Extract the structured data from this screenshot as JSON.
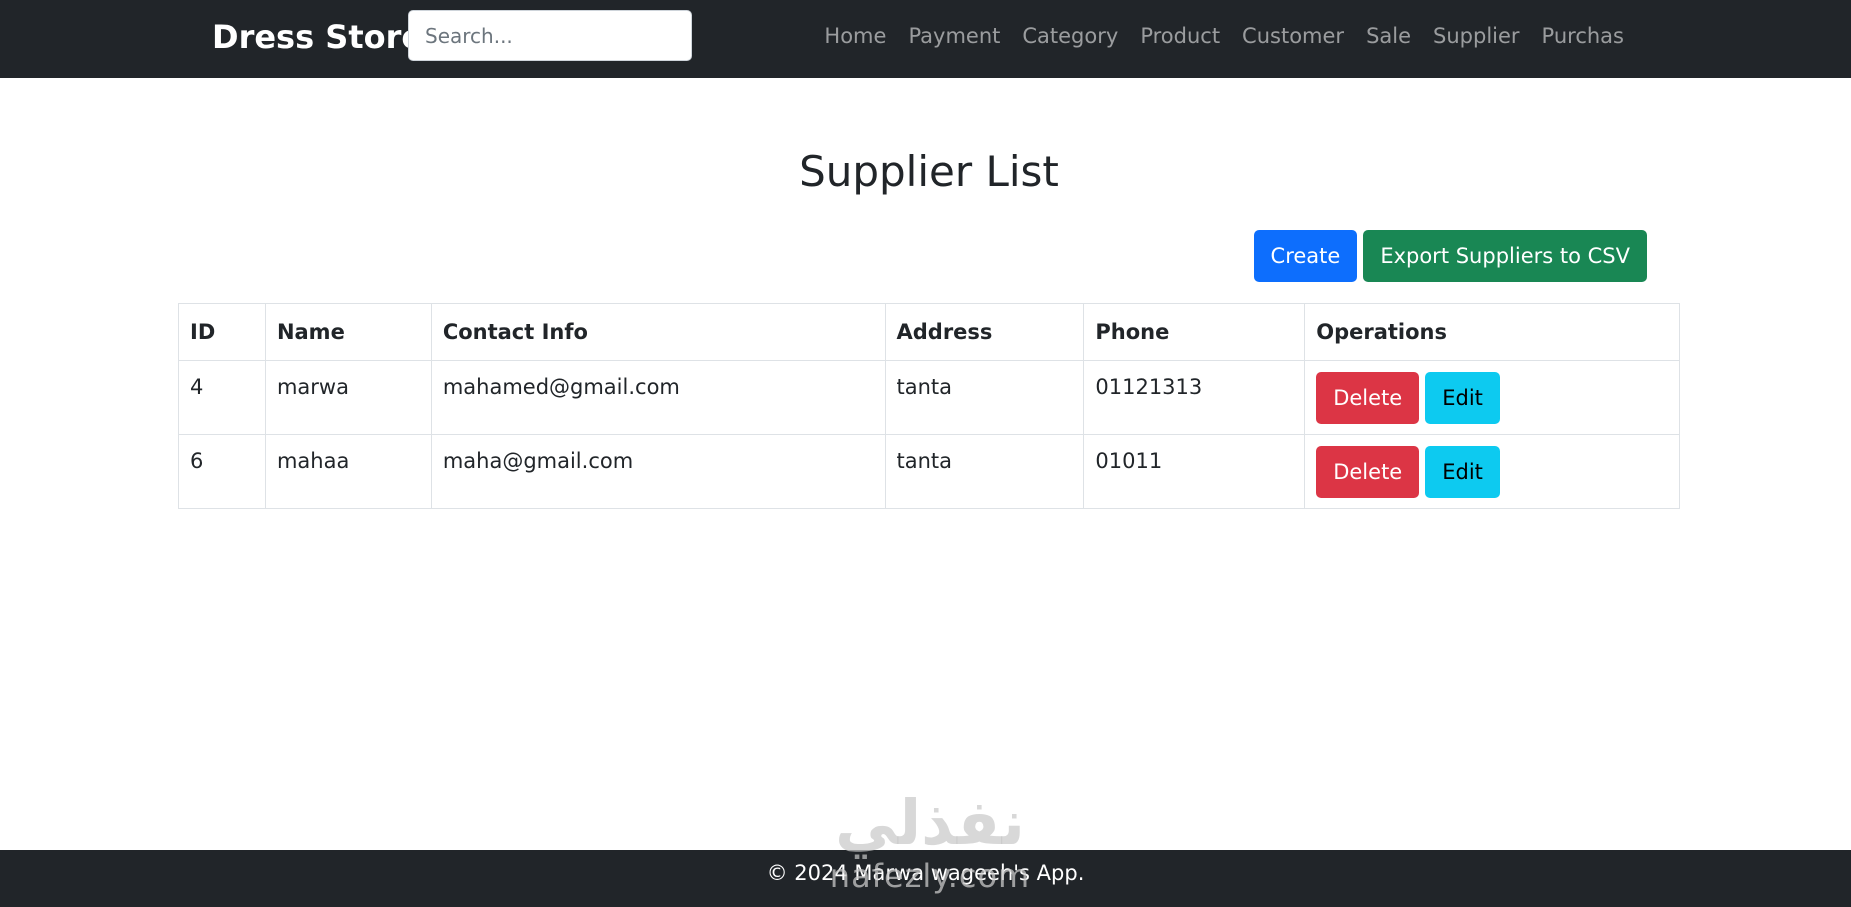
{
  "navbar": {
    "brand": "Dress Store",
    "search_placeholder": "Search...",
    "links": [
      "Home",
      "Payment",
      "Category",
      "Product",
      "Customer",
      "Sale",
      "Supplier",
      "Purchas"
    ]
  },
  "main": {
    "title": "Supplier List",
    "create_label": "Create",
    "export_label": "Export Suppliers to CSV",
    "table": {
      "headers": [
        "ID",
        "Name",
        "Contact Info",
        "Address",
        "Phone",
        "Operations"
      ],
      "rows": [
        {
          "id": "4",
          "name": "marwa",
          "contact": "mahamed@gmail.com",
          "address": "tanta",
          "phone": "01121313",
          "delete_label": "Delete",
          "edit_label": "Edit"
        },
        {
          "id": "6",
          "name": "mahaa",
          "contact": "maha@gmail.com",
          "address": "tanta",
          "phone": "01011",
          "delete_label": "Delete",
          "edit_label": "Edit"
        }
      ]
    }
  },
  "footer": {
    "text": "© 2024 Marwa wageeh's App."
  },
  "watermark": {
    "logo_text_ar": "نفذلي",
    "logo_text_en": "nafezly.com"
  },
  "colors": {
    "navbar_bg": "#212529",
    "primary": "#0d6efd",
    "success": "#198754",
    "danger": "#dc3545",
    "info": "#0dcaf0"
  }
}
